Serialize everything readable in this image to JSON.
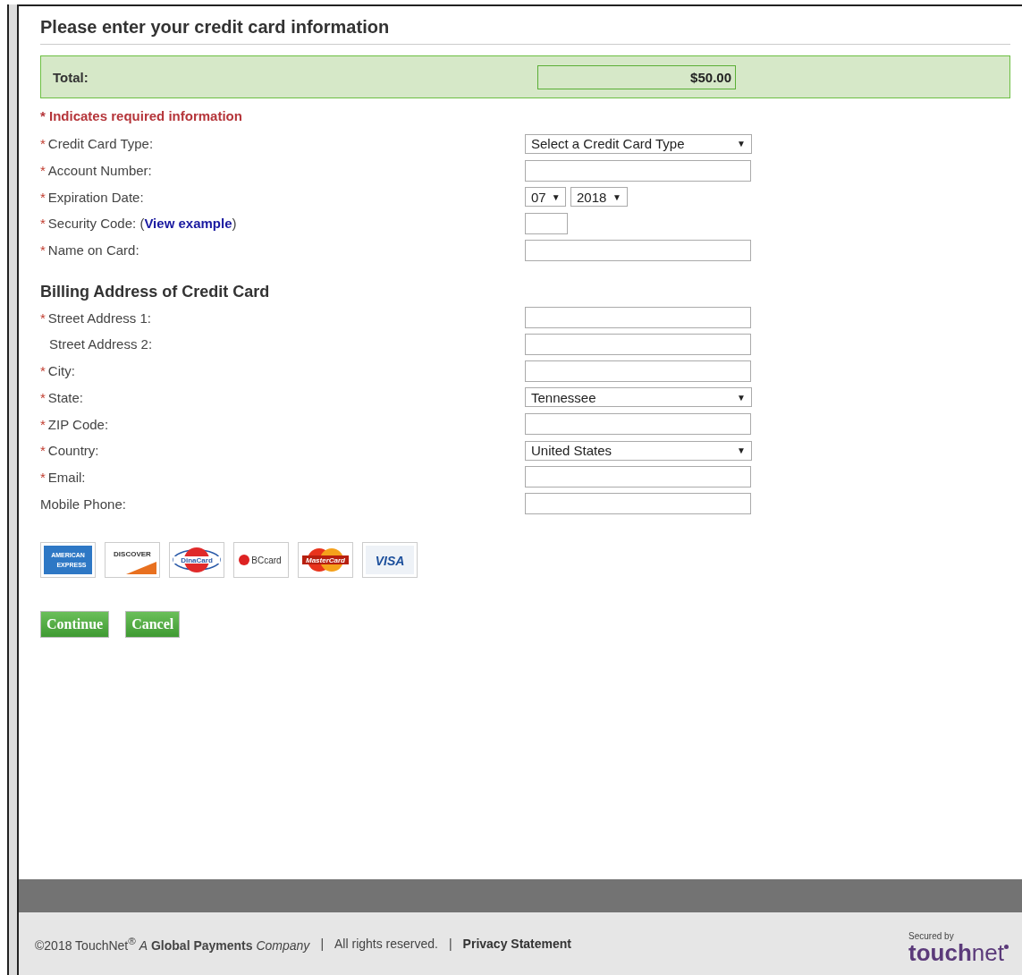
{
  "title": "Please enter your credit card information",
  "total": {
    "label": "Total:",
    "amount": "$50.00"
  },
  "required_note": {
    "marker": "*",
    "text": "Indicates required information"
  },
  "card_fields": [
    {
      "label": "Credit Card Type:",
      "required": true,
      "kind": "select",
      "value": "Select a Credit Card Type"
    },
    {
      "label": "Account Number:",
      "required": true,
      "kind": "input"
    },
    {
      "label": "Expiration Date:",
      "required": true,
      "kind": "expiry",
      "month": "07",
      "year": "2018"
    },
    {
      "label": "Security Code: (",
      "link": "View example",
      "suffix": ")",
      "required": true,
      "kind": "short"
    },
    {
      "label": "Name on Card:",
      "required": true,
      "kind": "input"
    }
  ],
  "billing_heading": "Billing Address of Credit Card",
  "billing_fields": [
    {
      "label": "Street Address 1:",
      "required": true,
      "kind": "input"
    },
    {
      "label": "Street Address 2:",
      "required": false,
      "indent": true,
      "kind": "input"
    },
    {
      "label": "City:",
      "required": true,
      "kind": "input"
    },
    {
      "label": "State:",
      "required": true,
      "kind": "select",
      "value": "Tennessee"
    },
    {
      "label": "ZIP Code:",
      "required": true,
      "kind": "input"
    },
    {
      "label": "Country:",
      "required": true,
      "kind": "select",
      "value": "United States"
    },
    {
      "label": "Email:",
      "required": true,
      "kind": "input"
    },
    {
      "label": "Mobile Phone:",
      "required": false,
      "indent": false,
      "kind": "input"
    }
  ],
  "dropdown_arrow": "▼",
  "cards": [
    {
      "kind": "amex",
      "lines": [
        "AMERICAN",
        "EXPRESS"
      ]
    },
    {
      "kind": "discover",
      "lines": [
        "DISCOVER"
      ]
    },
    {
      "kind": "dinacard",
      "lines": [
        "DinaCard"
      ]
    },
    {
      "kind": "bccard",
      "lines": [
        "BCcard"
      ]
    },
    {
      "kind": "mastercard",
      "lines": [
        "MasterCard"
      ]
    },
    {
      "kind": "visa",
      "lines": [
        "VISA"
      ]
    }
  ],
  "buttons": [
    "Continue",
    "Cancel"
  ],
  "footer": {
    "copyright": "©2018 TouchNet$^{®}$ *A* **Global Payments** *Company*",
    "separator": "|",
    "rights": "All rights reserved.",
    "privacy": "Privacy Statement",
    "logo": {
      "caption": "Secured by",
      "bold": "touch",
      "light": "net"
    }
  }
}
